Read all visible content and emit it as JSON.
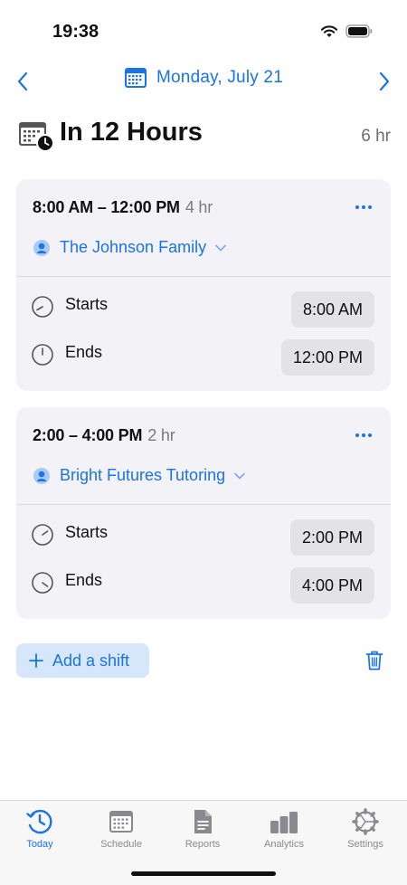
{
  "status": {
    "time": "19:38"
  },
  "date_nav": {
    "date": "Monday, July 21"
  },
  "summary": {
    "title": "In 12 Hours",
    "total": "6 hr"
  },
  "shifts": [
    {
      "range": "8:00 AM – 12:00 PM",
      "duration": "4 hr",
      "client": "The Johnson Family",
      "start_label": "Starts",
      "start_time": "8:00 AM",
      "end_label": "Ends",
      "end_time": "12:00 PM"
    },
    {
      "range": "2:00 – 4:00 PM",
      "duration": "2 hr",
      "client": "Bright Futures Tutoring",
      "start_label": "Starts",
      "start_time": "2:00 PM",
      "end_label": "Ends",
      "end_time": "4:00 PM"
    }
  ],
  "actions": {
    "add_shift": "Add a shift"
  },
  "tabs": [
    {
      "label": "Today",
      "icon": "clock-arrows-icon",
      "active": true
    },
    {
      "label": "Schedule",
      "icon": "calendar-icon",
      "active": false
    },
    {
      "label": "Reports",
      "icon": "document-icon",
      "active": false
    },
    {
      "label": "Analytics",
      "icon": "bar-chart-icon",
      "active": false
    },
    {
      "label": "Settings",
      "icon": "gear-icon",
      "active": false
    }
  ],
  "colors": {
    "accent": "#1a73e8",
    "card": "#f2f2f7",
    "pill": "#e2e2e7",
    "add_bg": "#d6e7fb"
  }
}
